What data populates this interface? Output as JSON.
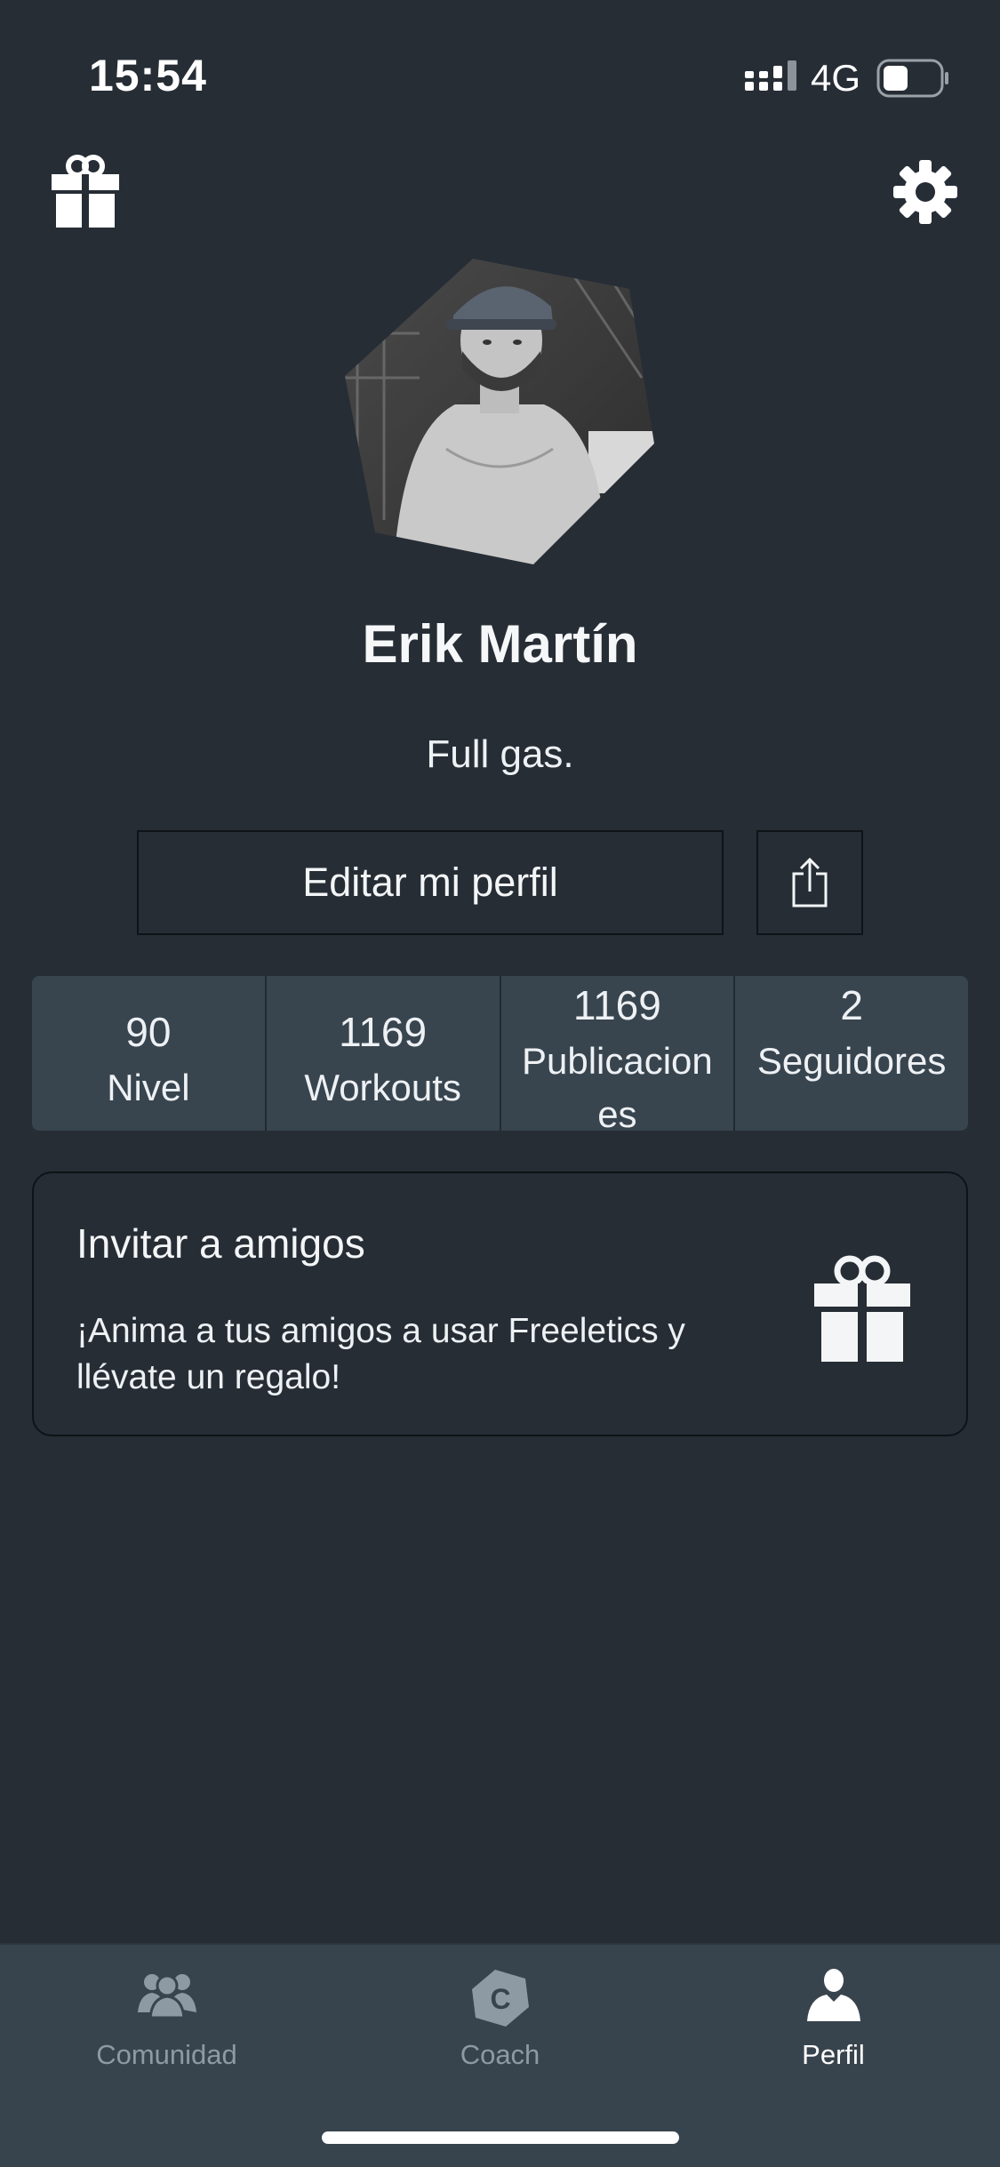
{
  "status_bar": {
    "time": "15:54",
    "network": "4G",
    "battery_level": 0.45,
    "signal_bars": 3
  },
  "header": {
    "left_icon": "gift-icon",
    "right_icon": "gear-icon"
  },
  "profile": {
    "name": "Erik Martín",
    "bio": "Full gas.",
    "avatar": "user-photo",
    "edit_label": "Editar mi perfil",
    "share_icon": "share-icon"
  },
  "stats": [
    {
      "value": "90",
      "label": "Nivel"
    },
    {
      "value": "1169",
      "label": "Workouts"
    },
    {
      "value": "1169",
      "label": "Publicaciones"
    },
    {
      "value": "2",
      "label": "Seguidores"
    }
  ],
  "invite": {
    "title": "Invitar a amigos",
    "description": "¡Anima a tus amigos a usar Freeletics y llévate un regalo!",
    "icon": "gift-icon"
  },
  "tabs": [
    {
      "label": "Comunidad",
      "icon": "community-icon",
      "active": false
    },
    {
      "label": "Coach",
      "icon": "coach-icon",
      "icon_letter": "C",
      "active": false
    },
    {
      "label": "Perfil",
      "icon": "profile-icon",
      "active": true
    }
  ],
  "colors": {
    "background": "#262d35",
    "stats_bg": "#38454f",
    "tab_bar_bg": "#38444d",
    "tab_inactive": "#8d9aa4",
    "tab_active": "#ffffff"
  }
}
